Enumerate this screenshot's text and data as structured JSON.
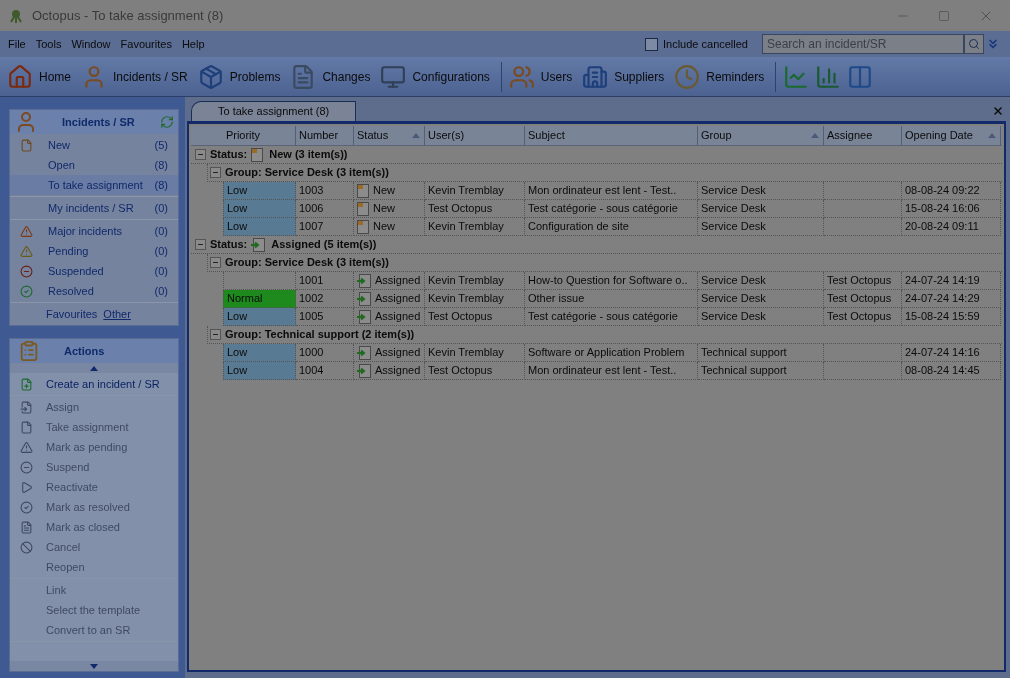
{
  "window": {
    "title": "Octopus - To take assignment (8)"
  },
  "menu": [
    "File",
    "Tools",
    "Window",
    "Favourites",
    "Help"
  ],
  "include_cancelled": {
    "label": "Include cancelled",
    "checked": false
  },
  "search": {
    "placeholder": "Search an incident/SR"
  },
  "toolbar": [
    [
      {
        "label": "Home",
        "kind": "home"
      },
      {
        "label": "Incidents / SR",
        "kind": "incidents"
      },
      {
        "label": "Problems",
        "kind": "problems"
      },
      {
        "label": "Changes",
        "kind": "changes"
      },
      {
        "label": "Configurations",
        "kind": "configurations"
      }
    ],
    [
      {
        "label": "Users",
        "kind": "users"
      },
      {
        "label": "Suppliers",
        "kind": "suppliers"
      },
      {
        "label": "Reminders",
        "kind": "reminders"
      }
    ],
    [
      {
        "kind": "line_chart"
      },
      {
        "kind": "bar_chart"
      },
      {
        "kind": "columns"
      }
    ]
  ],
  "incidents_panel": {
    "title": "Incidents / SR",
    "sections": [
      [
        {
          "label": "New",
          "count": "(5)",
          "kind": "new",
          "selected": false
        },
        {
          "label": "Open",
          "count": "(8)",
          "selected": false
        },
        {
          "label": "To take assignment",
          "count": "(8)",
          "selected": true
        }
      ],
      [
        {
          "label": "My incidents / SR",
          "count": "(0)",
          "selected": false
        }
      ],
      [
        {
          "label": "Major incidents",
          "count": "(0)",
          "kind": "major",
          "selected": false
        },
        {
          "label": "Pending",
          "count": "(0)",
          "kind": "pending",
          "selected": false
        },
        {
          "label": "Suspended",
          "count": "(0)",
          "kind": "suspended",
          "selected": false
        },
        {
          "label": "Resolved",
          "count": "(0)",
          "kind": "resolved",
          "selected": false
        }
      ]
    ],
    "favourites": {
      "label": "Favourites",
      "link": "Other"
    }
  },
  "actions_panel": {
    "title": "Actions",
    "sections": [
      [
        {
          "label": "Create an incident / SR",
          "kind": "create",
          "disabled": false
        }
      ],
      [
        {
          "label": "Assign",
          "kind": "assign",
          "disabled": true
        },
        {
          "label": "Take assignment",
          "kind": "take",
          "disabled": true
        },
        {
          "label": "Mark as pending",
          "kind": "pending",
          "disabled": true
        },
        {
          "label": "Suspend",
          "kind": "suspend",
          "disabled": true
        },
        {
          "label": "Reactivate",
          "kind": "reactivate",
          "disabled": true
        },
        {
          "label": "Mark as resolved",
          "kind": "resolved",
          "disabled": true
        },
        {
          "label": "Mark as closed",
          "kind": "closed",
          "disabled": true
        },
        {
          "label": "Cancel",
          "kind": "cancel",
          "disabled": true
        },
        {
          "label": "Reopen",
          "disabled": true
        }
      ],
      [
        {
          "label": "Link",
          "disabled": true
        },
        {
          "label": "Select the template",
          "disabled": true
        },
        {
          "label": "Convert to an SR",
          "disabled": true
        }
      ]
    ]
  },
  "tab": {
    "label": "To take assignment (8)",
    "selected": true
  },
  "table": {
    "columns": [
      {
        "label": "Priority",
        "sorted": false
      },
      {
        "label": "Number",
        "sorted": false
      },
      {
        "label": "Status",
        "sorted": true
      },
      {
        "label": "User(s)",
        "sorted": false
      },
      {
        "label": "Subject",
        "sorted": false
      },
      {
        "label": "Group",
        "sorted": true
      },
      {
        "label": "Assignee",
        "sorted": false
      },
      {
        "label": "Opening Date",
        "sorted": true
      }
    ],
    "status_groups": [
      {
        "label": "Status:",
        "status": "New (3 item(s))",
        "kind": "new",
        "expanded": true,
        "groups": [
          {
            "label": "Group: Service Desk (3 item(s))",
            "expanded": true,
            "rows": [
              {
                "priority": "Low",
                "color": "#587a92",
                "number": "1003",
                "status": "New",
                "kind": "new",
                "users": "Kevin Tremblay",
                "subject": "Mon ordinateur est lent - Test..",
                "group": "Service Desk",
                "date": "08-08-24 09:22"
              },
              {
                "priority": "Low",
                "color": "#587a92",
                "number": "1006",
                "status": "New",
                "kind": "new",
                "users": "Test Octopus",
                "subject": "Test catégorie - sous catégorie",
                "group": "Service Desk",
                "date": "15-08-24 16:06"
              },
              {
                "priority": "Low",
                "color": "#587a92",
                "number": "1007",
                "status": "New",
                "kind": "new",
                "users": "Kevin Tremblay",
                "subject": "Configuration de site",
                "group": "Service Desk",
                "date": "20-08-24 09:11"
              }
            ]
          }
        ]
      },
      {
        "label": "Status:",
        "status": "Assigned (5 item(s))",
        "kind": "assigned",
        "expanded": true,
        "groups": [
          {
            "label": "Group: Service Desk (3 item(s))",
            "expanded": true,
            "rows": [
              {
                "number": "1001",
                "status": "Assigned",
                "kind": "assigned",
                "users": "Kevin Tremblay",
                "subject": "How-to Question for Software o..",
                "group": "Service Desk",
                "assignee": "Test Octopus",
                "date": "24-07-24 14:19"
              },
              {
                "priority": "Normal",
                "color": "#1e8a1e",
                "number": "1002",
                "status": "Assigned",
                "kind": "assigned",
                "users": "Kevin Tremblay",
                "subject": "Other issue",
                "group": "Service Desk",
                "assignee": "Test Octopus",
                "date": "24-07-24 14:29"
              },
              {
                "priority": "Low",
                "color": "#587a92",
                "number": "1005",
                "status": "Assigned",
                "kind": "assigned",
                "users": "Test Octopus",
                "subject": "Test catégorie - sous catégorie",
                "group": "Service Desk",
                "assignee": "Test Octopus",
                "date": "15-08-24 15:59"
              }
            ]
          },
          {
            "label": "Group: Technical support (2 item(s))",
            "expanded": true,
            "rows": [
              {
                "priority": "Low",
                "color": "#587a92",
                "number": "1000",
                "status": "Assigned",
                "kind": "assigned",
                "users": "Kevin Tremblay",
                "subject": "Software or Application Problem",
                "group": "Technical support",
                "date": "24-07-24 14:16"
              },
              {
                "priority": "Low",
                "color": "#587a92",
                "number": "1004",
                "status": "Assigned",
                "kind": "assigned",
                "users": "Test Octopus",
                "subject": "Mon ordinateur est lent - Test..",
                "group": "Technical support",
                "date": "08-08-24 14:45"
              }
            ]
          }
        ]
      }
    ]
  }
}
